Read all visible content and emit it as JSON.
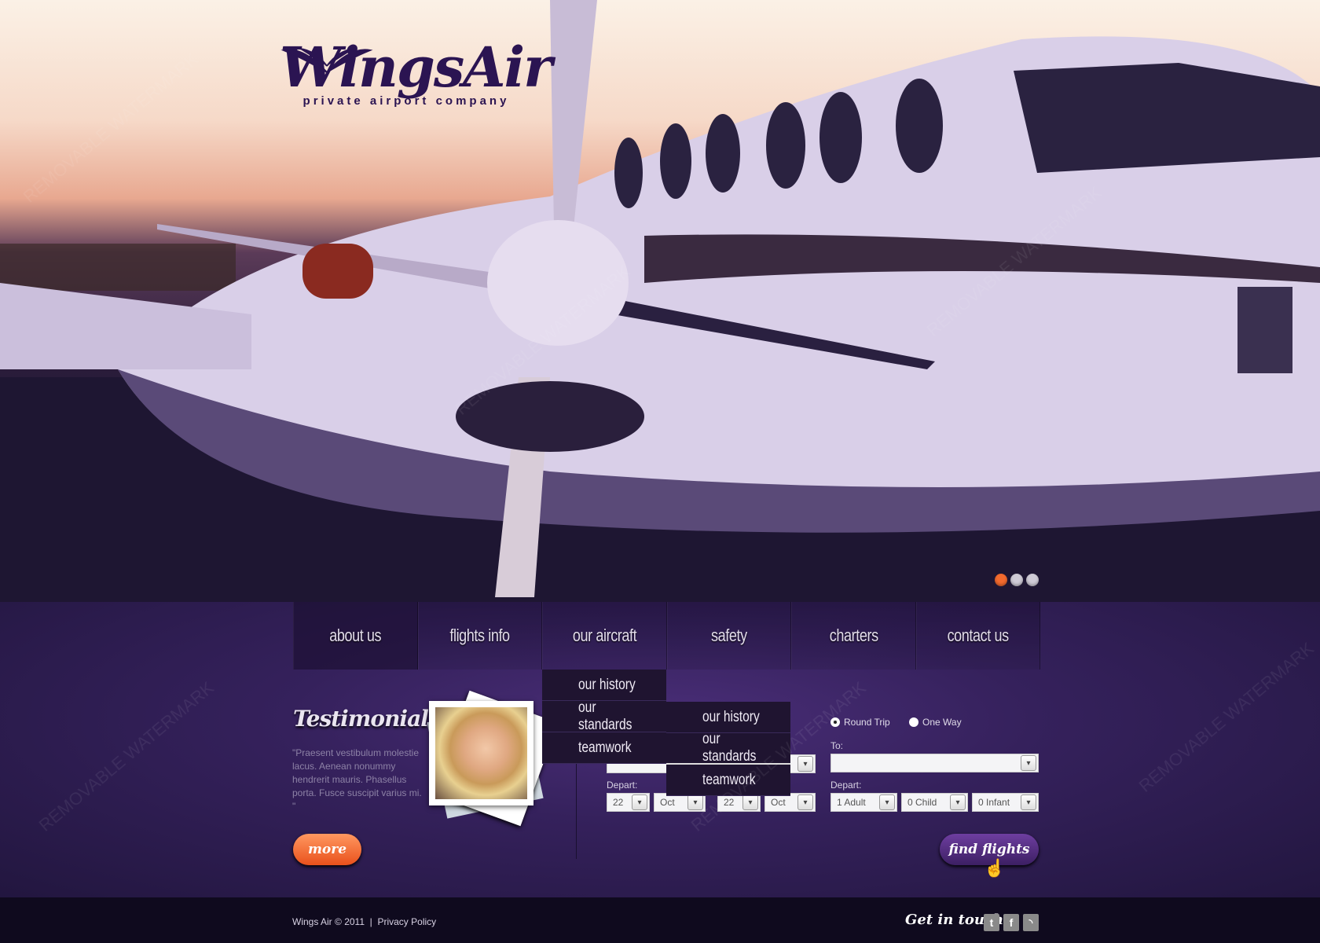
{
  "brand": {
    "name": "WingsAir",
    "tagline": "private airport company"
  },
  "slider": {
    "slides": 3,
    "active": 0,
    "colors": {
      "active": "#f26a2e",
      "inactive": "#cfcbd6"
    }
  },
  "nav": {
    "items": [
      "about us",
      "flights info",
      "our aircraft",
      "safety",
      "charters",
      "contact us"
    ],
    "dropdown": [
      "our history",
      "our standards",
      "teamwork"
    ],
    "submenu": [
      "our history",
      "our standards",
      "teamwork"
    ]
  },
  "testimonials": {
    "title": "Testimonials",
    "quote": "\"Praesent vestibulum molestie lacus. Aenean nonummy hendrerit mauris. Phasellus porta. Fusce suscipit varius mi. \"",
    "more_label": "more"
  },
  "booking": {
    "trip_types": [
      {
        "label": "Round Trip",
        "selected": true
      },
      {
        "label": "One Way",
        "selected": false
      }
    ],
    "to_label": "To:",
    "to_value": "",
    "from_value": "",
    "depart_label": "Depart:",
    "left_dates": [
      {
        "day": "22",
        "month": "Oct"
      },
      {
        "day": "22",
        "month": "Oct"
      }
    ],
    "passengers": [
      "1 Adult",
      "0 Child",
      "0 Infant"
    ],
    "find_label": "find flights"
  },
  "footer": {
    "copyright": "Wings Air © 2011",
    "separator": "|",
    "privacy": "Privacy Policy",
    "get_in_touch": "Get in touch",
    "social": [
      "twitter-icon",
      "facebook-icon",
      "rss-icon"
    ]
  },
  "watermark": "REMOVABLE WATERMARK"
}
